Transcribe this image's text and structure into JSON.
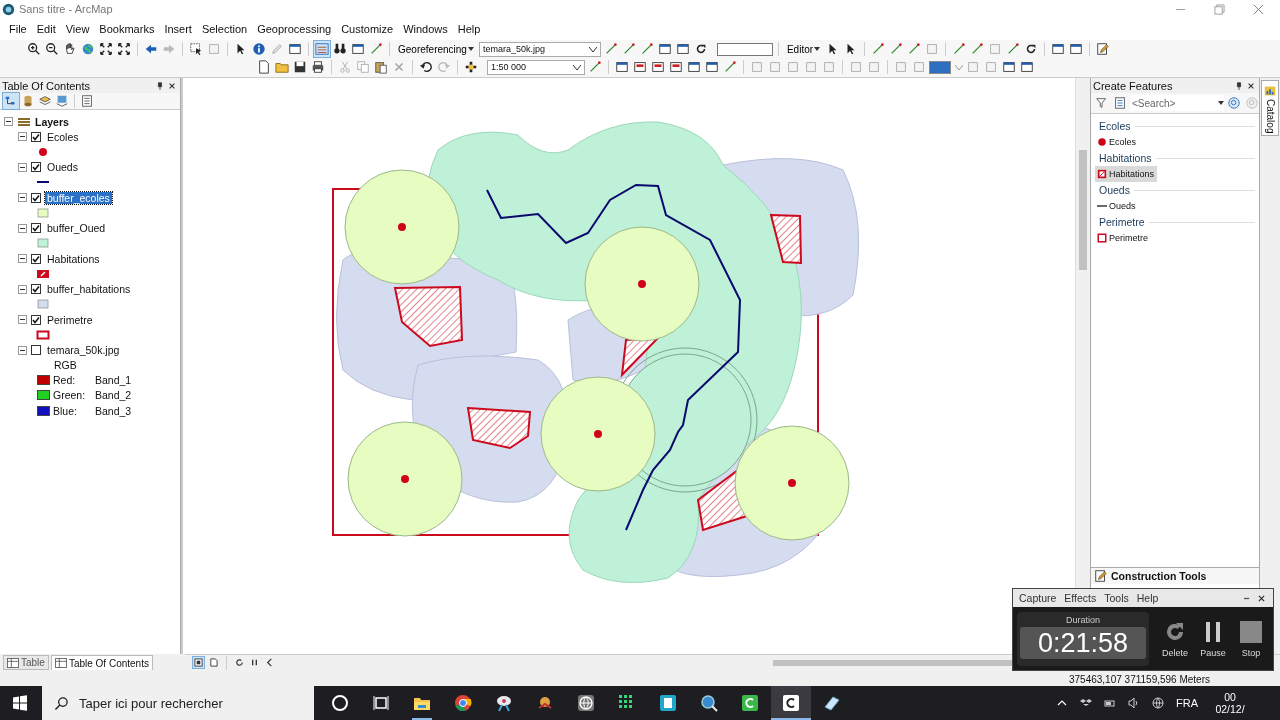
{
  "window": {
    "title": "Sans titre - ArcMap"
  },
  "menu": [
    "File",
    "Edit",
    "View",
    "Bookmarks",
    "Insert",
    "Selection",
    "Geoprocessing",
    "Customize",
    "Windows",
    "Help"
  ],
  "toolbar": {
    "georef_label": "Georeferencing",
    "layer_select": "temara_50k.jpg",
    "scale": "1:50 000",
    "editor_label": "Editor"
  },
  "toc": {
    "title": "Table Of Contents",
    "root": "Layers",
    "layers": [
      {
        "name": "Ecoles",
        "checked": true,
        "selected": false,
        "kind": "point",
        "color": "#d0021b"
      },
      {
        "name": "Oueds",
        "checked": true,
        "selected": false,
        "kind": "line",
        "color": "#0a0a6e"
      },
      {
        "name": "buffer_ecoles",
        "checked": true,
        "selected": true,
        "kind": "fill",
        "color": "#e6fcc0"
      },
      {
        "name": "buffer_Oued",
        "checked": true,
        "selected": false,
        "kind": "fill",
        "color": "#bff0d8"
      },
      {
        "name": "Habitations",
        "checked": true,
        "selected": false,
        "kind": "hatched",
        "color": "#cc0a1e"
      },
      {
        "name": "buffer_habitations",
        "checked": true,
        "selected": false,
        "kind": "fill",
        "color": "#d6dcf0"
      },
      {
        "name": "Perimetre",
        "checked": true,
        "selected": false,
        "kind": "outline",
        "color": "#cc0a1e"
      }
    ],
    "raster": {
      "name": "temara_50k.jpg",
      "checked": false,
      "mode": "RGB",
      "bands": [
        {
          "label": "Red:",
          "band": "Band_1",
          "color": "#c00000"
        },
        {
          "label": "Green:",
          "band": "Band_2",
          "color": "#20d020"
        },
        {
          "label": "Blue:",
          "band": "Band_3",
          "color": "#1010c0"
        }
      ]
    }
  },
  "bottom_tabs": [
    {
      "label": "Table",
      "selected": false
    },
    {
      "label": "Table Of Contents",
      "selected": true
    }
  ],
  "create_features": {
    "title": "Create Features",
    "search_placeholder": "<Search>",
    "groups": [
      {
        "name": "Ecoles",
        "template": "Ecoles",
        "kind": "point",
        "selected": false
      },
      {
        "name": "Habitations",
        "template": "Habitations",
        "kind": "hatched",
        "selected": true
      },
      {
        "name": "Oueds",
        "template": "Oueds",
        "kind": "line",
        "selected": false
      },
      {
        "name": "Perimetre",
        "template": "Perimetre",
        "kind": "outline",
        "selected": false
      }
    ],
    "construction_tools": "Construction Tools"
  },
  "catalog_tab": "Catalog",
  "recorder": {
    "menu": [
      "Capture",
      "Effects",
      "Tools",
      "Help"
    ],
    "duration_label": "Duration",
    "duration": "0:21:58",
    "buttons": [
      {
        "kind": "delete",
        "label": "Delete"
      },
      {
        "kind": "pause",
        "label": "Pause"
      },
      {
        "kind": "stop",
        "label": "Stop"
      }
    ]
  },
  "status_bar": {
    "coordinates": "375463,107  371159,596 Meters"
  },
  "taskbar": {
    "search_placeholder": "Taper ici pour rechercher",
    "language": "FRA",
    "time": "00",
    "date": "02/12/"
  }
}
